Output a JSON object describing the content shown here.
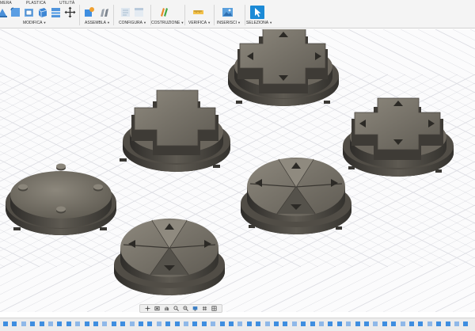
{
  "toolbar": {
    "workspace_tabs": [
      "MERA",
      "PLASTICA",
      "UTILITÀ"
    ],
    "groups": [
      {
        "label": "MODIFICA"
      },
      {
        "label": "ASSEMBLA"
      },
      {
        "label": "CONFIGURA"
      },
      {
        "label": "COSTRUZIONE"
      },
      {
        "label": "VERIFICA"
      },
      {
        "label": "INSERISCI"
      },
      {
        "label": "SELEZIONA"
      }
    ]
  },
  "colors": {
    "toolbar_bg": "#f4f4f4",
    "viewport_bg": "#fbfbfc",
    "grid_line": "#dcdde3",
    "model_dark": "#3e3c38",
    "model_mid": "#625e56",
    "model_light": "#8a857a",
    "select_blue": "#1c8ad6",
    "timeline_blue": "#3f8ee0"
  },
  "navbar": {
    "icons": [
      "orbit-icon",
      "look-at-icon",
      "pan-icon",
      "zoom-icon",
      "fit-icon",
      "display-settings-icon",
      "grid-settings-icon",
      "viewports-icon"
    ]
  },
  "timeline": {
    "marker_count": 52
  }
}
